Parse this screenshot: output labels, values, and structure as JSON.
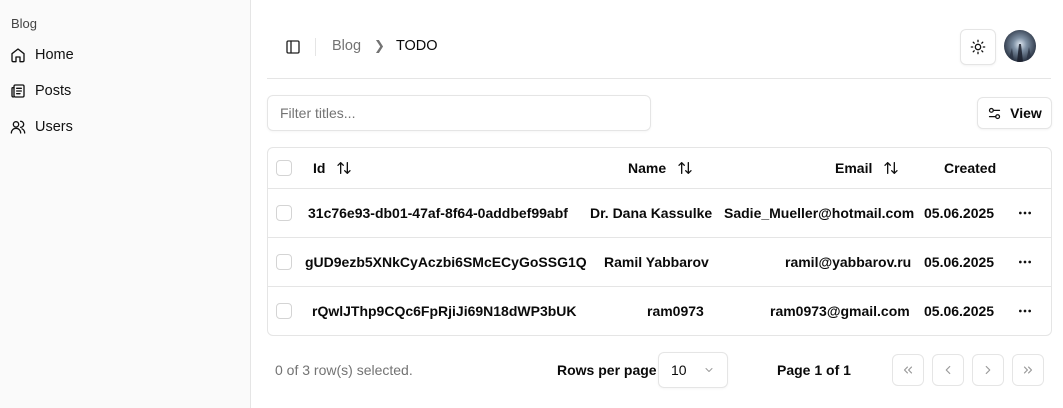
{
  "sidebar": {
    "group_label": "Blog",
    "items": [
      {
        "label": "Home",
        "icon": "home-icon"
      },
      {
        "label": "Posts",
        "icon": "posts-icon"
      },
      {
        "label": "Users",
        "icon": "users-icon"
      }
    ]
  },
  "header": {
    "breadcrumb": [
      {
        "label": "Blog"
      },
      {
        "label": "TODO"
      }
    ],
    "icons": {
      "toggle": "sidebar-toggle-icon",
      "theme": "sun-icon",
      "avatar": "avatar"
    }
  },
  "filter": {
    "placeholder": "Filter titles...",
    "value": ""
  },
  "view_button": {
    "label": "View",
    "icon": "sliders-icon"
  },
  "table": {
    "columns": [
      {
        "label": "Id",
        "sortable": true
      },
      {
        "label": "Name",
        "sortable": true
      },
      {
        "label": "Email",
        "sortable": true
      },
      {
        "label": "Created",
        "sortable": false
      }
    ],
    "rows": [
      {
        "id": "31c76e93-db01-47af-8f64-0addbef99abf",
        "name": "Dr. Dana Kassulke",
        "email": "Sadie_Mueller@hotmail.com",
        "created": "05.06.2025"
      },
      {
        "id": "gUD9ezb5XNkCyAczbi6SMcECyGoSSG1Q",
        "name": "Ramil Yabbarov",
        "email": "ramil@yabbarov.ru",
        "created": "05.06.2025"
      },
      {
        "id": "rQwlJThp9CQc6FpRjiJi69N18dWP3bUK",
        "name": "ram0973",
        "email": "ram0973@gmail.com",
        "created": "05.06.2025"
      }
    ]
  },
  "footer": {
    "selection": "0 of 3 row(s) selected.",
    "rows_per_page_label": "Rows per page",
    "rows_per_page_value": "10",
    "page_info": "Page 1 of 1"
  },
  "colors": {
    "border": "#e5e5e5",
    "muted": "#737373",
    "sidebar_bg": "#fafafa"
  }
}
